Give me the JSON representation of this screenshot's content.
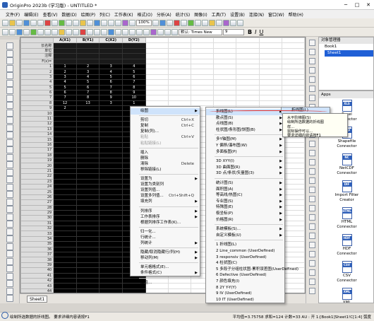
{
  "title": "OriginPro 2023b (学习版) - UNTITLED *",
  "menu": [
    "文件(F)",
    "编辑(E)",
    "查看(V)",
    "数据(D)",
    "绘图(P)",
    "列(C)",
    "工作表(K)",
    "格式(O)",
    "分析(A)",
    "统计(S)",
    "图像(I)",
    "工具(T)",
    "设置(B)",
    "连接(N)",
    "窗口(W)",
    "帮助(H)"
  ],
  "toolbar": {
    "zoom": "100%",
    "font": "默认: Times New",
    "size": "9",
    "bold": "B",
    "italic": "I",
    "underline": "U"
  },
  "sheet": {
    "columns": [
      "A(X1)",
      "B(Y1)",
      "C(X2)",
      "D(Y2)"
    ],
    "meta_rows": [
      "长名称",
      "单位",
      "注释",
      "F(x)="
    ],
    "rows": [
      [
        "1",
        "2",
        "3",
        "4"
      ],
      [
        "2",
        "3",
        "4",
        "5"
      ],
      [
        "3",
        "4",
        "5",
        "6"
      ],
      [
        "4",
        "5",
        "6",
        "7"
      ],
      [
        "5",
        "6",
        "7",
        "8"
      ],
      [
        "6",
        "7",
        "8",
        "9"
      ],
      [
        "7",
        "8",
        "9",
        "10"
      ],
      [
        "12",
        "13",
        "3",
        "1"
      ],
      [
        "2",
        "",
        "",
        ""
      ]
    ],
    "tab": "Sheet1"
  },
  "objmgr": {
    "title": "对象管理器",
    "book": "Book1",
    "sheet": "Sheet1"
  },
  "apps": {
    "title": "Apps",
    "items": [
      "XLS Excel Connector",
      "Shapefile Connector",
      "NetCDF Connector",
      "Import Filter Creator",
      "HTML Connector",
      "HDF Connector",
      "CSV Connector",
      "XML Connector"
    ]
  },
  "ctx_menu": [
    {
      "label": "绘图",
      "arrow": true,
      "hl": true
    },
    {
      "sep": true
    },
    {
      "label": "剪切",
      "sc": "Ctrl+X"
    },
    {
      "label": "复制",
      "sc": "Ctrl+C"
    },
    {
      "label": "复制(列)..."
    },
    {
      "label": "粘贴",
      "sc": "Ctrl+V",
      "dis": true
    },
    {
      "label": "粘贴链接(L)",
      "dis": true
    },
    {
      "sep": true
    },
    {
      "label": "插入"
    },
    {
      "label": "删除"
    },
    {
      "label": "清除",
      "sc": "Delete"
    },
    {
      "label": "移除链接(L)"
    },
    {
      "sep": true
    },
    {
      "label": "设置为",
      "arrow": true
    },
    {
      "label": "设置为类别列"
    },
    {
      "label": "设置列值..."
    },
    {
      "label": "设置多列值...",
      "sc": "Ctrl+Shift+Q"
    },
    {
      "label": "填充列",
      "arrow": true
    },
    {
      "sep": true
    },
    {
      "label": "列排序",
      "arrow": true
    },
    {
      "label": "工作表排序",
      "arrow": true
    },
    {
      "label": "根据列排序工作表(K)..."
    },
    {
      "sep": true
    },
    {
      "label": "归一化..."
    },
    {
      "label": "行统计..."
    },
    {
      "label": "列统计",
      "arrow": true
    },
    {
      "sep": true
    },
    {
      "label": "隐藏/取消隐藏行/列(H)",
      "arrow": true
    },
    {
      "label": "移动列(M)",
      "arrow": true
    },
    {
      "sep": true
    },
    {
      "label": "单元格格式(E)..."
    },
    {
      "label": "条件格式(C)",
      "arrow": true
    },
    {
      "sep": true
    },
    {
      "label": "属性..."
    }
  ],
  "sub_menu": [
    {
      "label": "折线图(L)",
      "arrow": true,
      "hl": true
    },
    {
      "label": "散点图(S)",
      "arrow": true
    },
    {
      "label": "点线图(B)",
      "arrow": true
    },
    {
      "label": "柱状图/条形图/饼图(B)",
      "arrow": true
    },
    {
      "sep": true
    },
    {
      "label": "多Y轴图(M)",
      "arrow": true
    },
    {
      "label": "Y 偏移/瀑布图(W)",
      "arrow": true
    },
    {
      "label": "多面板图(P)",
      "arrow": true
    },
    {
      "sep": true
    },
    {
      "label": "3D XYY(I)",
      "arrow": true
    },
    {
      "label": "3D 曲面图(R)",
      "arrow": true
    },
    {
      "label": "3D 点/条状/矢量图(3)",
      "arrow": true
    },
    {
      "sep": true
    },
    {
      "label": "统计图(S)",
      "arrow": true
    },
    {
      "label": "面积图(A)",
      "arrow": true
    },
    {
      "label": "等高线/热图(C)",
      "arrow": true
    },
    {
      "label": "专业图(S)",
      "arrow": true
    },
    {
      "label": "特殊图(E)",
      "arrow": true
    },
    {
      "label": "极坐标(P)",
      "arrow": true
    },
    {
      "label": "价格图(R)",
      "arrow": true
    },
    {
      "sep": true
    },
    {
      "label": "系统模板(S)...",
      "arrow": true
    },
    {
      "label": "自定义模板(U)",
      "arrow": true
    },
    {
      "sep": true
    },
    {
      "label": "1 折线图(L)"
    },
    {
      "label": "2 Line_common (UserDefined)"
    },
    {
      "label": "3 responsiv (UserDefined)"
    },
    {
      "label": "4 柱状图(C)"
    },
    {
      "label": "5 多段子分组柱状图-累积误差图(UserDefined)"
    },
    {
      "label": "6 Defective (UserDefined)"
    },
    {
      "label": "7 颜色填充(I)"
    },
    {
      "label": "8 2Y Y-Y(Y)"
    },
    {
      "label": "9 IV (UserDefined)"
    },
    {
      "label": "10 IT (UserDefined)"
    }
  ],
  "sub2_label": "折线图(L)",
  "tooltip": [
    "水平阶梯图(S)",
    "绘制所选数据的折线图",
    "样...",
    "鼠标操作可以...",
    "要求详细内容请按F1"
  ],
  "status": {
    "left": "绘制所选数据的折线图。 要求详细内容请按F1",
    "right": "平均值=3.75758 求和=124 计数=33   AU : 开   1:[Book1]Sheet1!C[1:4]   弧度"
  }
}
